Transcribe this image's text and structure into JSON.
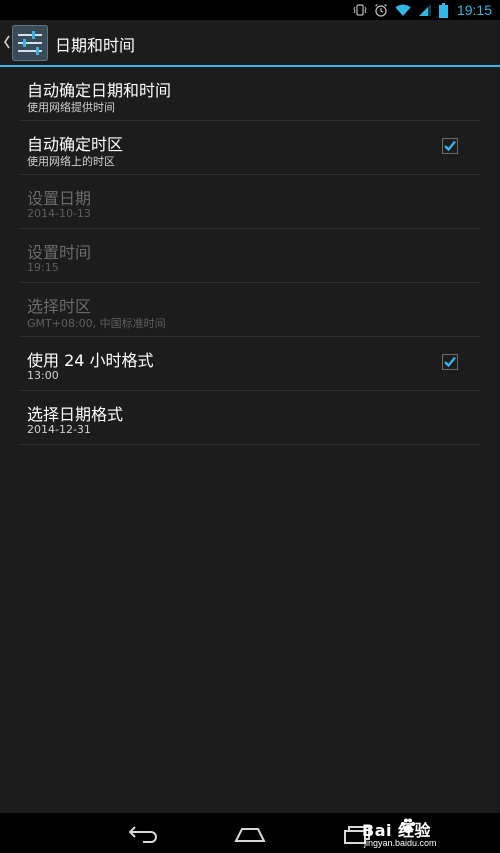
{
  "status_bar": {
    "time": "19:15",
    "icons": [
      "vibrate-icon",
      "alarm-icon",
      "wifi-icon",
      "cell-signal-icon",
      "battery-icon"
    ]
  },
  "action_bar": {
    "title": "日期和时间",
    "icon": "settings-sliders-icon"
  },
  "settings": {
    "items": [
      {
        "title": "自动确定日期和时间",
        "summary": "使用网络提供时间",
        "enabled": true,
        "checkbox": null
      },
      {
        "title": "自动确定时区",
        "summary": "使用网络上的时区",
        "enabled": true,
        "checkbox": true
      },
      {
        "title": "设置日期",
        "summary": "2014-10-13",
        "enabled": false,
        "checkbox": null
      },
      {
        "title": "设置时间",
        "summary": "19:15",
        "enabled": false,
        "checkbox": null
      },
      {
        "title": "选择时区",
        "summary": "GMT+08:00, 中国标准时间",
        "enabled": false,
        "checkbox": null
      },
      {
        "title": "使用 24 小时格式",
        "summary": "13:00",
        "enabled": true,
        "checkbox": true
      },
      {
        "title": "选择日期格式",
        "summary": "2014-12-31",
        "enabled": true,
        "checkbox": null
      }
    ]
  },
  "nav_bar": {
    "buttons": [
      "back-icon",
      "home-icon",
      "recents-icon"
    ]
  },
  "watermark": {
    "brand": "Bai  经验",
    "url": "jingyan.baidu.com"
  },
  "colors": {
    "accent": "#33b5e5",
    "background": "#1c1c1c"
  }
}
